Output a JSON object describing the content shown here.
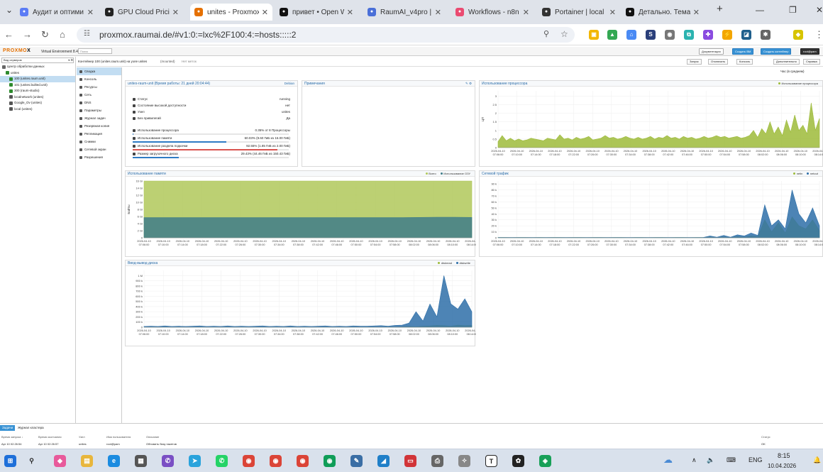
{
  "browser": {
    "tabs": [
      {
        "title": "Аудит и оптими",
        "icon": "gemini-icon",
        "color": "#5b7cf5",
        "active": false
      },
      {
        "title": "GPU Cloud Pricin",
        "icon": "page-icon",
        "color": "#222222",
        "active": false
      },
      {
        "title": "unites - Proxmox",
        "icon": "proxmox-icon",
        "color": "#e57000",
        "active": true
      },
      {
        "title": "привет • Open W",
        "icon": "openwebui-icon",
        "color": "#111111",
        "active": false
      },
      {
        "title": "RaumAI_v4pro |",
        "icon": "notion-icon",
        "color": "#4a6fd8",
        "active": false
      },
      {
        "title": "Workflows - n8n",
        "icon": "n8n-icon",
        "color": "#ea4b71",
        "active": false
      },
      {
        "title": "Portainer | local",
        "icon": "portainer-icon",
        "color": "#333333",
        "active": false
      },
      {
        "title": "Детально. Тема",
        "icon": "openwebui-icon",
        "color": "#111111",
        "active": false
      }
    ],
    "url": "proxmox.raumai.de/#v1:0:=lxc%2F100:4:=hosts:::::2"
  },
  "pve": {
    "logo_a": "PROXMO",
    "logo_b": "X",
    "version": "Virtual Environment 8.4.17",
    "search_placeholder": "Поиск",
    "top_buttons": {
      "docs": "Документация",
      "create_vm": "Создать ВМ",
      "create_ct": "Создать контейнер",
      "user": "root@pam"
    },
    "view_select": "Вид серверов",
    "tree": [
      {
        "label": "Центр обработки данных",
        "indent": 0,
        "icon": "datacenter-icon",
        "color": "#666666",
        "selected": false
      },
      {
        "label": "unites",
        "indent": 1,
        "icon": "node-icon",
        "color": "#2e8b2e",
        "selected": false
      },
      {
        "label": "100 (unites.raum.unit)",
        "indent": 2,
        "icon": "container-icon",
        "color": "#2e8b2e",
        "selected": true
      },
      {
        "label": "101 (unites.builted.unit)",
        "indent": 2,
        "icon": "container-icon",
        "color": "#2e8b2e",
        "selected": false
      },
      {
        "label": "300 (raum-studio)",
        "indent": 2,
        "icon": "container-icon",
        "color": "#2e8b2e",
        "selected": false
      },
      {
        "label": "localnetwork (unites)",
        "indent": 2,
        "icon": "network-icon",
        "color": "#555555",
        "selected": false
      },
      {
        "label": "Google_Ov (unites)",
        "indent": 2,
        "icon": "storage-icon",
        "color": "#555555",
        "selected": false
      },
      {
        "label": "local (unites)",
        "indent": 2,
        "icon": "storage-icon",
        "color": "#555555",
        "selected": false
      }
    ],
    "breadcrumb": "Контейнер 100 (unites.raum.unit) на узле unites",
    "tags": "(mounted)",
    "notags": "Нет меток",
    "actions": {
      "start": "Запуск",
      "shutdown": "Отключить",
      "console": "Консоль",
      "more": "Дополнительно",
      "help": "Справка"
    },
    "menu": [
      {
        "label": "Сводка",
        "selected": true
      },
      {
        "label": "Консоль",
        "selected": false
      },
      {
        "label": "Ресурсы",
        "selected": false
      },
      {
        "label": "Сеть",
        "selected": false
      },
      {
        "label": "DNS",
        "selected": false
      },
      {
        "label": "Параметры",
        "selected": false
      },
      {
        "label": "Журнал задач",
        "selected": false
      },
      {
        "label": "Резервная копия",
        "selected": false
      },
      {
        "label": "Репликация",
        "selected": false
      },
      {
        "label": "Снимки",
        "selected": false
      },
      {
        "label": "Сетевой экран",
        "selected": false
      },
      {
        "label": "Разрешения",
        "selected": false
      }
    ],
    "timeframe": "Час (в среднем)"
  },
  "summary": {
    "title": "unites-raum-unit (Время работы: 21 дней 20:04:44)",
    "os": "Debian",
    "rows": [
      {
        "label": "Статус",
        "value": "running",
        "icon": "info-icon"
      },
      {
        "label": "Состояние высокой доступности",
        "value": "нет",
        "icon": "heartbeat-icon"
      },
      {
        "label": "Узел",
        "value": "unites",
        "icon": "node-icon"
      },
      {
        "label": "Без привилегий",
        "value": "Да",
        "icon": "lock-icon"
      }
    ],
    "metrics": [
      {
        "label": "Использование процессора",
        "value": "0.35% от 8 Процессоры",
        "fraction": 0.0035,
        "color": "#2e7bc4"
      },
      {
        "label": "Использование памяти",
        "value": "60.03% (9.60 ГиБ из 16.00 ГиБ)",
        "fraction": 0.6003,
        "color": "#2e7bc4"
      },
      {
        "label": "Использование раздела подкачки",
        "value": "92.55% (1.85 ГиБ из 2.00 ГиБ)",
        "fraction": 0.9255,
        "color": "#d9534f"
      },
      {
        "label": "Размер загрузочного диска",
        "value": "29.43% (44.46 ГиБ из 150.43 ГиБ)",
        "fraction": 0.2943,
        "color": "#2e7bc4"
      }
    ]
  },
  "notes": {
    "title": "Примечания"
  },
  "times": [
    "2026-04-10 07:06:00",
    "2026-04-10 07:10:00",
    "2026-04-10 07:14:00",
    "2026-04-10 07:18:00",
    "2026-04-10 07:22:00",
    "2026-04-10 07:26:00",
    "2026-04-10 07:30:00",
    "2026-04-10 07:34:00",
    "2026-04-10 07:38:00",
    "2026-04-10 07:42:00",
    "2026-04-10 07:46:00",
    "2026-04-10 07:50:00",
    "2026-04-10 07:54:00",
    "2026-04-10 07:58:00",
    "2026-04-10 08:02:00",
    "2026-04-10 08:06:00",
    "2026-04-10 08:10:00",
    "2026-04-10 08:14:00"
  ],
  "chart_data": [
    {
      "type": "area",
      "title": "Использование процессора",
      "ylabel": "ЦП",
      "yticks": [
        "0",
        "0.5",
        "1",
        "1.5",
        "2",
        "2.5",
        "3"
      ],
      "ylim": [
        0,
        3.3
      ],
      "series": [
        {
          "name": "Использование процессора",
          "color": "#9dbb3a",
          "values": [
            0.35,
            0.7,
            0.4,
            0.55,
            0.4,
            0.5,
            0.4,
            0.45,
            0.55,
            0.5,
            0.45,
            0.4,
            0.55,
            0.5,
            0.45,
            0.75,
            0.5,
            0.55,
            0.45,
            0.6,
            0.5,
            0.55,
            0.65,
            0.45,
            0.5,
            0.55,
            0.7,
            0.55,
            0.6,
            0.5,
            0.55,
            0.65,
            0.55,
            0.5,
            0.6,
            0.5,
            0.55,
            0.65,
            0.5,
            0.6,
            0.55,
            0.7,
            0.55,
            0.6,
            0.5,
            0.65,
            0.55,
            0.6,
            0.5,
            0.55,
            0.65,
            0.55,
            0.6,
            0.7,
            0.6,
            0.65,
            0.55,
            0.6,
            0.65,
            0.55,
            0.6,
            0.7,
            1.0,
            0.6,
            1.1,
            0.8,
            1.5,
            0.8,
            1.2,
            0.7,
            1.6,
            0.9,
            1.9,
            1.0,
            1.3,
            0.8,
            2.6,
            1.0,
            1.7
          ]
        }
      ]
    },
    {
      "type": "area",
      "title": "Использование памяти",
      "ylabel": "Байты",
      "yticks": [
        "0",
        "2 Gi",
        "4 Gi",
        "6 Gi",
        "8 Gi",
        "10 Gi",
        "12 Gi",
        "14 Gi",
        "16 Gi"
      ],
      "ylim": [
        0,
        16
      ],
      "series": [
        {
          "name": "Всего",
          "color": "#b0c85a",
          "values": [
            16,
            16,
            16,
            16,
            16,
            16,
            16,
            16,
            16,
            16,
            16,
            16,
            16,
            16,
            16,
            16,
            16,
            16,
            16,
            16
          ]
        },
        {
          "name": "Использование ОЗУ",
          "color": "#3f7d88",
          "values": [
            5.7,
            5.7,
            5.7,
            5.7,
            5.7,
            5.7,
            5.7,
            5.7,
            5.7,
            5.7,
            5.7,
            5.7,
            5.7,
            5.7,
            5.7,
            5.7,
            5.75,
            5.8,
            5.8,
            5.75
          ]
        }
      ]
    },
    {
      "type": "area",
      "title": "Сетевой трафик",
      "yticks": [
        "0",
        "10 k",
        "20 k",
        "30 k",
        "40 k",
        "50 k",
        "60 k",
        "70 k",
        "80 k",
        "90 k"
      ],
      "ylim": [
        0,
        95
      ],
      "series": [
        {
          "name": "netin",
          "color": "#9dbb3a",
          "values": [
            0.5,
            0.5,
            0.4,
            0.5,
            0.5,
            0.4,
            0.5,
            0.4,
            0.5,
            0.5,
            0.4,
            0.5,
            0.5,
            0.4,
            0.5,
            0.5,
            0.4,
            0.5,
            0.5,
            0.4,
            0.5,
            0.5,
            0.4,
            0.5,
            0.5,
            0.4,
            0.5,
            0.5,
            0.4,
            0.5,
            0.5,
            1.5,
            0.5,
            1.5,
            0.5,
            2,
            1,
            3,
            2,
            30,
            10,
            25,
            8,
            35,
            20,
            15,
            30,
            12
          ]
        },
        {
          "name": "netout",
          "color": "#2e6fa8",
          "values": [
            0.5,
            0.6,
            0.5,
            0.5,
            0.6,
            0.5,
            0.5,
            0.6,
            0.5,
            0.5,
            0.6,
            0.5,
            0.5,
            0.6,
            0.5,
            0.5,
            0.6,
            0.5,
            0.5,
            0.6,
            0.5,
            0.5,
            0.6,
            0.5,
            0.5,
            0.6,
            0.5,
            0.5,
            0.6,
            0.5,
            0.5,
            3,
            1,
            4,
            1,
            5,
            3,
            8,
            4,
            55,
            20,
            30,
            15,
            80,
            40,
            25,
            50,
            20
          ]
        }
      ]
    },
    {
      "type": "area",
      "title": "Ввод-вывод диска",
      "yticks": [
        "0",
        "100 k",
        "200 k",
        "300 k",
        "400 k",
        "500 k",
        "600 k",
        "700 k",
        "800 k",
        "900 k",
        "1 M"
      ],
      "ylim": [
        0,
        1100
      ],
      "series": [
        {
          "name": "diskread",
          "color": "#9dbb3a",
          "values": [
            5,
            5,
            4,
            5,
            5,
            4,
            5,
            5,
            4,
            5,
            5,
            4,
            5,
            5,
            4,
            5,
            5,
            4,
            5,
            5,
            4,
            5,
            5,
            4,
            5,
            5,
            4,
            5,
            5,
            4,
            5,
            5,
            4,
            5,
            5,
            4,
            5,
            8,
            15,
            10,
            20,
            25,
            35,
            30,
            20,
            40,
            30,
            35
          ]
        },
        {
          "name": "diskwrite",
          "color": "#2e6fa8",
          "values": [
            15,
            20,
            15,
            25,
            15,
            20,
            15,
            20,
            25,
            15,
            20,
            15,
            25,
            15,
            20,
            15,
            20,
            25,
            15,
            20,
            15,
            25,
            15,
            20,
            15,
            20,
            25,
            15,
            20,
            15,
            25,
            20,
            20,
            25,
            30,
            20,
            35,
            40,
            80,
            300,
            120,
            450,
            200,
            1000,
            450,
            350,
            550,
            300
          ]
        }
      ]
    }
  ],
  "log": {
    "tabs": [
      "Задачи",
      "Журнал кластера"
    ],
    "headers": [
      "Время запуска ↓",
      "Время окончания",
      "Узел",
      "Имя пользователя",
      "Описание",
      "Статус"
    ],
    "row": [
      "Apr 10 02:26:54",
      "Apr 10 02:26:57",
      "unites",
      "root@pam",
      "Обновить базу пакетов",
      "OK"
    ]
  },
  "taskbar": {
    "time": "8:15",
    "date": "10.04.2026",
    "lang": "ENG"
  }
}
